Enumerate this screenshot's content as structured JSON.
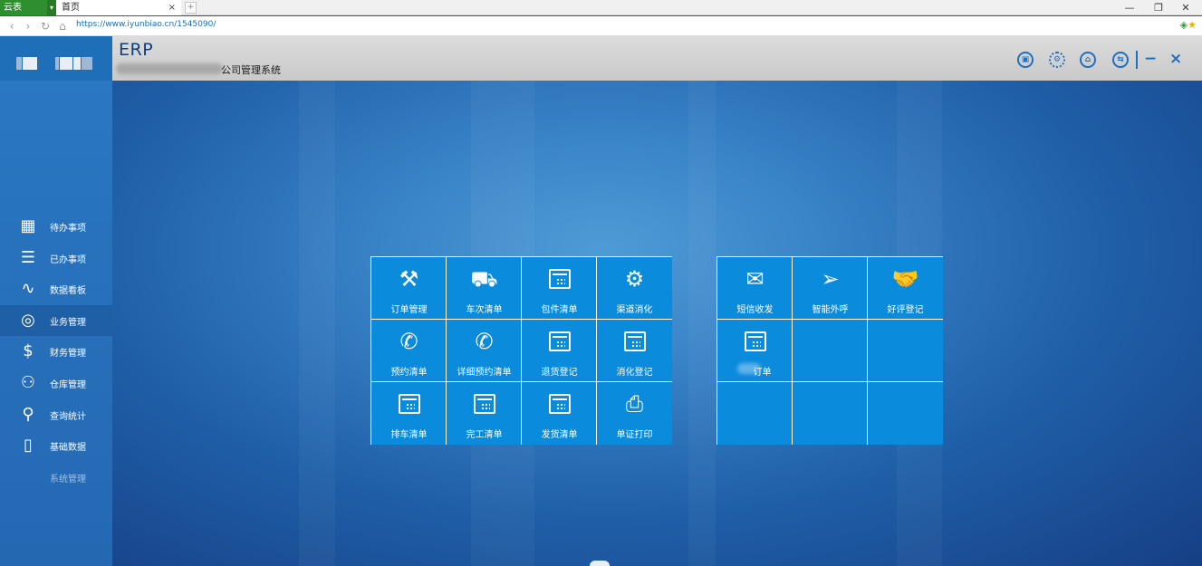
{
  "browser": {
    "brand": "云表",
    "tab_title": "首页",
    "tab_close": "×",
    "new_tab": "+",
    "url": "https://www.iyunbiao.cn/1545090/",
    "win_min": "—",
    "win_restore": "❐",
    "win_close": "✕",
    "ext_icons": "◈★"
  },
  "header": {
    "app_title": "ERP",
    "company_name": "公司管理系统",
    "icons": [
      "lock-icon",
      "gear-icon",
      "home-icon",
      "switch-icon"
    ],
    "minimize": "−",
    "close": "×"
  },
  "sidebar": {
    "items": [
      {
        "label": "待办事项",
        "icon": "calendar-icon",
        "glyph": "▦"
      },
      {
        "label": "已办事项",
        "icon": "checklist-icon",
        "glyph": "☰"
      },
      {
        "label": "数据看板",
        "icon": "pulse-icon",
        "glyph": "∿"
      },
      {
        "label": "业务管理",
        "icon": "target-icon",
        "glyph": "◎",
        "active": true
      },
      {
        "label": "财务管理",
        "icon": "money-icon",
        "glyph": "$"
      },
      {
        "label": "仓库管理",
        "icon": "network-icon",
        "glyph": "⚇"
      },
      {
        "label": "查询统计",
        "icon": "search-icon",
        "glyph": "⚲"
      },
      {
        "label": "基础数据",
        "icon": "bars-icon",
        "glyph": "▯"
      },
      {
        "label": "系统管理",
        "icon": "",
        "glyph": ""
      }
    ]
  },
  "tiles_left": [
    {
      "label": "订单管理",
      "icon": "tools-icon",
      "glyph": "⚒"
    },
    {
      "label": "车次清单",
      "icon": "truck-icon",
      "glyph": "⛟"
    },
    {
      "label": "包件清单",
      "icon": "calendar-icon",
      "glyph": ""
    },
    {
      "label": "渠道消化",
      "icon": "gear-icon",
      "glyph": "⚙"
    },
    {
      "label": "预约清单",
      "icon": "phone-icon",
      "glyph": "✆"
    },
    {
      "label": "详细预约清单",
      "icon": "phone-icon",
      "glyph": "✆"
    },
    {
      "label": "退货登记",
      "icon": "calendar-icon",
      "glyph": ""
    },
    {
      "label": "消化登记",
      "icon": "calendar-icon",
      "glyph": ""
    },
    {
      "label": "排车清单",
      "icon": "calendar-icon",
      "glyph": ""
    },
    {
      "label": "完工清单",
      "icon": "calendar-icon",
      "glyph": ""
    },
    {
      "label": "发货清单",
      "icon": "calendar-icon",
      "glyph": ""
    },
    {
      "label": "单证打印",
      "icon": "printer-icon",
      "glyph": "⎙"
    }
  ],
  "tiles_right": [
    {
      "label": "短信收发",
      "icon": "mail-icon",
      "glyph": "✉"
    },
    {
      "label": "智能外呼",
      "icon": "paper-plane-icon",
      "glyph": "➢"
    },
    {
      "label": "好评登记",
      "icon": "handshake-icon",
      "glyph": "🤝"
    },
    {
      "label": "订单",
      "icon": "calendar-icon",
      "glyph": ""
    }
  ]
}
